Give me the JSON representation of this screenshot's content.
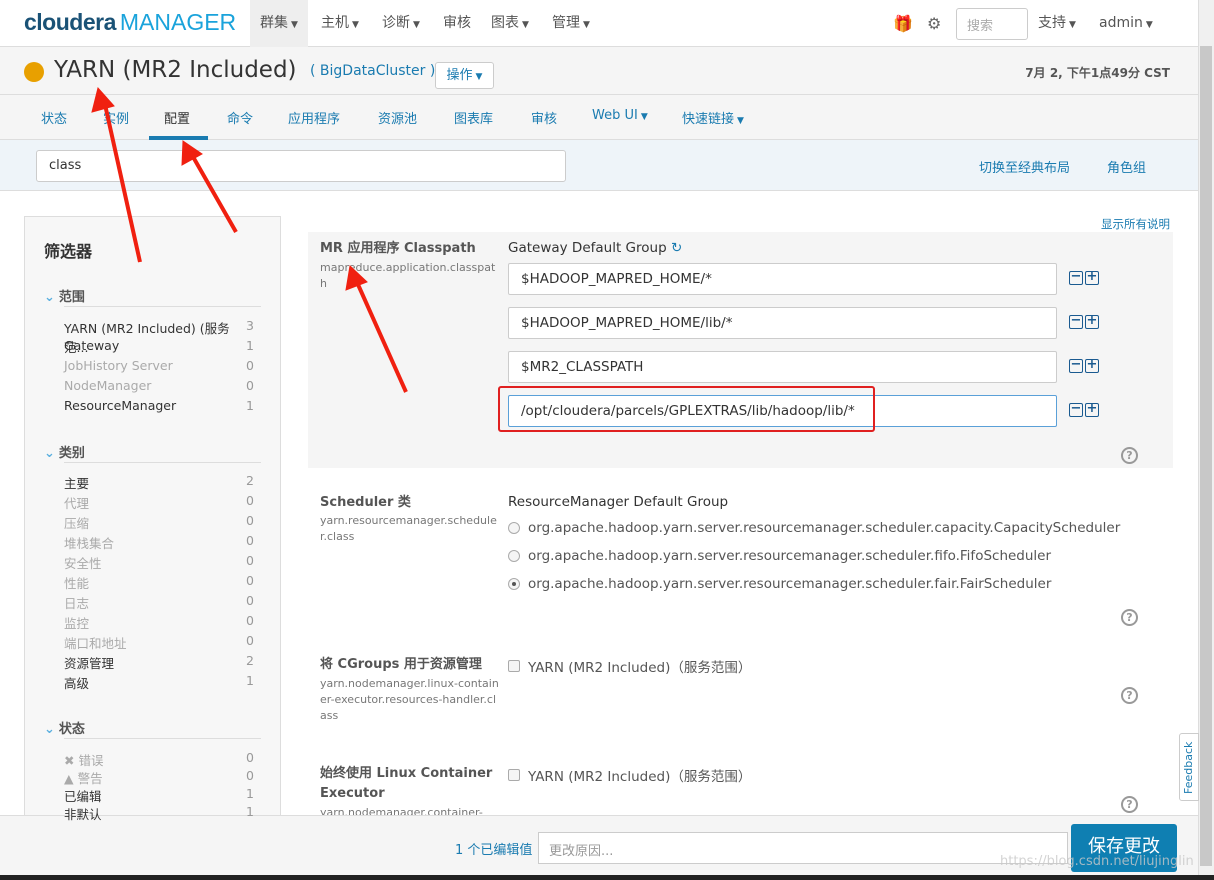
{
  "topnav": {
    "logo": "cloudera",
    "logo_sub": "MANAGER",
    "items": [
      {
        "label": "群集",
        "caret": true
      },
      {
        "label": "主机",
        "caret": true
      },
      {
        "label": "诊断",
        "caret": true
      },
      {
        "label": "审核",
        "caret": false
      },
      {
        "label": "图表",
        "caret": true
      },
      {
        "label": "管理",
        "caret": true
      }
    ],
    "search_placeholder": "搜索",
    "support": "支持",
    "user": "admin"
  },
  "header": {
    "status_color": "#e8a000",
    "title": "YARN (MR2 Included)",
    "cluster": "( BigDataCluster )",
    "actions": "操作",
    "time": "7月 2, 下午1点49分 CST"
  },
  "tabs": [
    "状态",
    "实例",
    "配置",
    "命令",
    "应用程序",
    "资源池",
    "图表库",
    "审核",
    "Web UI",
    "快速链接"
  ],
  "active_tab": "配置",
  "filter": {
    "value": "class",
    "switch_layout": "切换至经典布局",
    "role_groups": "角色组",
    "show_all_desc": "显示所有说明"
  },
  "sidebar": {
    "title": "筛选器",
    "scope": {
      "heading": "范围",
      "items": [
        {
          "label": "YARN (MR2 Included) (服务范...",
          "count": "3",
          "dim": false
        },
        {
          "label": "Gateway",
          "count": "1",
          "dim": false
        },
        {
          "label": "JobHistory Server",
          "count": "0",
          "dim": true
        },
        {
          "label": "NodeManager",
          "count": "0",
          "dim": true
        },
        {
          "label": "ResourceManager",
          "count": "1",
          "dim": false
        }
      ]
    },
    "category": {
      "heading": "类别",
      "items": [
        {
          "label": "主要",
          "count": "2",
          "dim": false
        },
        {
          "label": "代理",
          "count": "0",
          "dim": true
        },
        {
          "label": "压缩",
          "count": "0",
          "dim": true
        },
        {
          "label": "堆栈集合",
          "count": "0",
          "dim": true
        },
        {
          "label": "安全性",
          "count": "0",
          "dim": true
        },
        {
          "label": "性能",
          "count": "0",
          "dim": true
        },
        {
          "label": "日志",
          "count": "0",
          "dim": true
        },
        {
          "label": "监控",
          "count": "0",
          "dim": true
        },
        {
          "label": "端口和地址",
          "count": "0",
          "dim": true
        },
        {
          "label": "资源管理",
          "count": "2",
          "dim": false
        },
        {
          "label": "高级",
          "count": "1",
          "dim": false
        }
      ]
    },
    "status": {
      "heading": "状态",
      "items": [
        {
          "label": "✖ 错误",
          "count": "0",
          "dim": true
        },
        {
          "label": "▲ 警告",
          "count": "0",
          "dim": true
        },
        {
          "label": "已编辑",
          "count": "1",
          "dim": false
        },
        {
          "label": "非默认",
          "count": "1",
          "dim": false
        }
      ]
    }
  },
  "props": [
    {
      "label": "MR 应用程序 Classpath",
      "key": "mapreduce.application.classpath",
      "group": "Gateway Default Group",
      "values": [
        "$HADOOP_MAPRED_HOME/*",
        "$HADOOP_MAPRED_HOME/lib/*",
        "$MR2_CLASSPATH",
        "/opt/cloudera/parcels/GPLEXTRAS/lib/hadoop/lib/*"
      ]
    },
    {
      "label": "Scheduler 类",
      "key": "yarn.resourcemanager.scheduler.class",
      "group": "ResourceManager Default Group",
      "options": [
        "org.apache.hadoop.yarn.server.resourcemanager.scheduler.capacity.CapacityScheduler",
        "org.apache.hadoop.yarn.server.resourcemanager.scheduler.fifo.FifoScheduler",
        "org.apache.hadoop.yarn.server.resourcemanager.scheduler.fair.FairScheduler"
      ],
      "selected": 2
    },
    {
      "label": "将 CGroups 用于资源管理",
      "key": "yarn.nodemanager.linux-container-executor.resources-handler.class",
      "checkbox": "YARN (MR2 Included)（服务范围）"
    },
    {
      "label": "始终使用 Linux Container Executor",
      "key": "yarn.nodemanager.container-",
      "checkbox": "YARN (MR2 Included)（服务范围）"
    }
  ],
  "footer": {
    "edited": "1 个已编辑值",
    "reason_placeholder": "更改原因...",
    "save": "保存更改"
  },
  "feedback": "Feedback",
  "watermark": "https://blog.csdn.net/liujinglin"
}
